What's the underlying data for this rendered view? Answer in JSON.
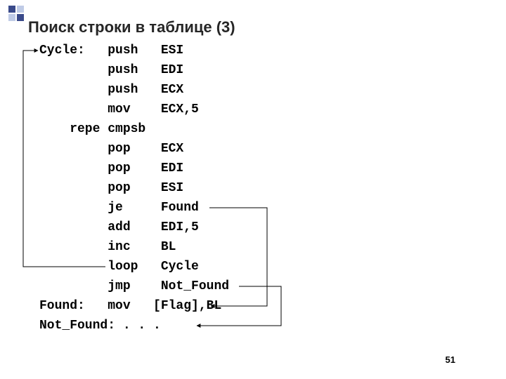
{
  "title": "Поиск строки в таблице (3)",
  "page_number": "51",
  "code": {
    "line1": "Cycle:   push   ESI",
    "line2": "         push   EDI",
    "line3": "         push   ECX",
    "line4": "         mov    ECX,5",
    "line5": "    repe cmpsb",
    "line6": "         pop    ECX",
    "line7": "         pop    EDI",
    "line8": "         pop    ESI",
    "line9": "         je     Found",
    "line10": "         add    EDI,5",
    "line11": "         inc    BL",
    "line12": "         loop   Cycle",
    "line13": "         jmp    Not_Found",
    "line14": "Found:   mov   [Flag],BL",
    "line15": "Not_Found: . . ."
  }
}
